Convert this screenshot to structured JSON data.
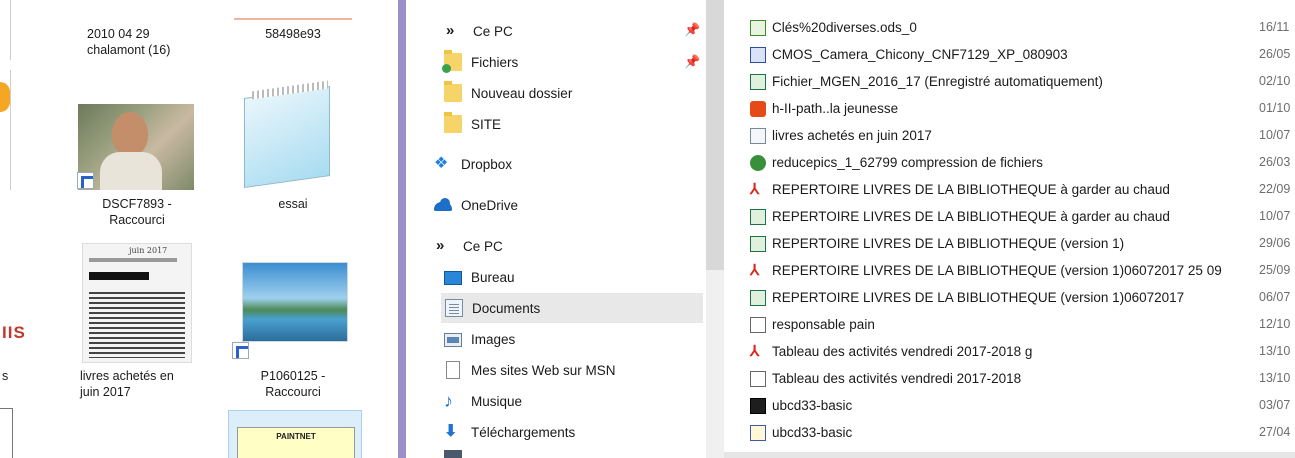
{
  "desktop": {
    "items": [
      {
        "label": "2010 04 29\nchalamont (16)"
      },
      {
        "label": "58498e93"
      },
      {
        "label": "DSCF7893 -\nRaccourci"
      },
      {
        "label": "essai"
      },
      {
        "label": "livres achetés en\njuin 2017"
      },
      {
        "label": "P1060125 -\nRaccourci"
      }
    ],
    "partial_left_labels": [
      "s",
      "s"
    ],
    "paintnet_label": "PAINTNET",
    "scan_text": "juin 2017"
  },
  "nav": {
    "items": [
      {
        "label": "Ce PC",
        "icon": "chevron-icon"
      },
      {
        "label": "Fichiers",
        "icon": "folder-sync-icon"
      },
      {
        "label": "Nouveau dossier",
        "icon": "folder-icon"
      },
      {
        "label": "SITE",
        "icon": "folder-icon"
      },
      {
        "label": "Dropbox",
        "icon": "dropbox-icon"
      },
      {
        "label": "OneDrive",
        "icon": "onedrive-icon"
      },
      {
        "label": "Ce PC",
        "icon": "chevron-icon"
      },
      {
        "label": "Bureau",
        "icon": "desktop-folder-icon"
      },
      {
        "label": "Documents",
        "icon": "documents-folder-icon"
      },
      {
        "label": "Images",
        "icon": "pictures-folder-icon"
      },
      {
        "label": "Mes sites Web sur MSN",
        "icon": "file-icon"
      },
      {
        "label": "Musique",
        "icon": "music-icon"
      },
      {
        "label": "Téléchargements",
        "icon": "download-icon"
      }
    ],
    "selected": "Documents"
  },
  "files": {
    "rows": [
      {
        "name": "Clés%20diverses.ods_0",
        "date": "16/11",
        "icon": "spreadsheet-ods-icon"
      },
      {
        "name": "CMOS_Camera_Chicony_CNF7129_XP_080903",
        "date": "26/05",
        "icon": "archive-icon"
      },
      {
        "name": "Fichier_MGEN_2016_17 (Enregistré automatiquement)",
        "date": "02/10",
        "icon": "excel-icon"
      },
      {
        "name": "h-II-path..la jeunesse",
        "date": "01/10",
        "icon": "media-icon"
      },
      {
        "name": "livres achetés en juin 2017",
        "date": "10/07",
        "icon": "image-file-icon"
      },
      {
        "name": "reducepics_1_62799 compression de fichiers",
        "date": "26/03",
        "icon": "installer-icon"
      },
      {
        "name": "REPERTOIRE LIVRES DE LA BIBLIOTHEQUE  à garder au chaud",
        "date": "22/09",
        "icon": "pdf-icon"
      },
      {
        "name": "REPERTOIRE LIVRES DE LA BIBLIOTHEQUE  à garder au chaud",
        "date": "10/07",
        "icon": "excel-icon"
      },
      {
        "name": "REPERTOIRE LIVRES DE LA BIBLIOTHEQUE (version 1)",
        "date": "29/06",
        "icon": "excel-icon"
      },
      {
        "name": "REPERTOIRE LIVRES DE LA BIBLIOTHEQUE (version 1)06072017 25 09",
        "date": "25/09",
        "icon": "pdf-icon"
      },
      {
        "name": "REPERTOIRE LIVRES DE LA BIBLIOTHEQUE (version 1)06072017",
        "date": "06/07",
        "icon": "excel-icon"
      },
      {
        "name": "responsable pain",
        "date": "12/10",
        "icon": "document-icon"
      },
      {
        "name": "Tableau des activités vendredi 2017-2018 g",
        "date": "13/10",
        "icon": "pdf-icon"
      },
      {
        "name": "Tableau des activités vendredi 2017-2018",
        "date": "13/10",
        "icon": "document-icon"
      },
      {
        "name": "ubcd33-basic",
        "date": "03/07",
        "icon": "7z-archive-icon"
      },
      {
        "name": "ubcd33-basic",
        "date": "27/04",
        "icon": "disc-image-icon"
      }
    ]
  }
}
